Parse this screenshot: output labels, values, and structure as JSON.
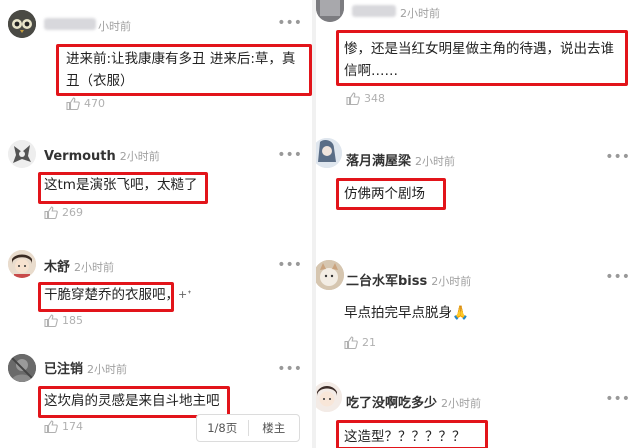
{
  "left": {
    "comments": [
      {
        "name": "",
        "time": "小时前",
        "text": "进来前:让我康康有多丑 进来后:草，真丑（衣服）",
        "likes": "470"
      },
      {
        "name": "Vermouth",
        "time": "2小时前",
        "text": "这tm是演张飞吧，太糙了",
        "likes": "269"
      },
      {
        "name": "木舒",
        "time": "2小时前",
        "text": "干脆穿楚乔的衣服吧，",
        "extra": "+ᐩ",
        "likes": "185"
      },
      {
        "name": "已注销",
        "time": "2小时前",
        "text": "这坎肩的灵感是来自斗地主吧",
        "likes": "174"
      }
    ]
  },
  "right": {
    "comments": [
      {
        "name": "",
        "time": "2小时前",
        "text": "惨，还是当红女明星做主角的待遇，说出去谁信啊……",
        "likes": "348"
      },
      {
        "name": "落月满屋梁",
        "time": "2小时前",
        "text": "仿佛两个剧场",
        "likes": ""
      },
      {
        "name": "二台水军biss",
        "time": "2小时前",
        "text": "早点拍完早点脱身🙏",
        "likes": "21"
      },
      {
        "name": "吃了没啊吃多少",
        "time": "2小时前",
        "text": "这造型？？？？？？",
        "likes": ""
      }
    ]
  },
  "pager": {
    "page": "1/8页",
    "op": "楼主"
  },
  "icons": {
    "more": "more-dots-icon",
    "like": "thumb-up-icon"
  },
  "colors": {
    "highlight": "#e2141a"
  }
}
